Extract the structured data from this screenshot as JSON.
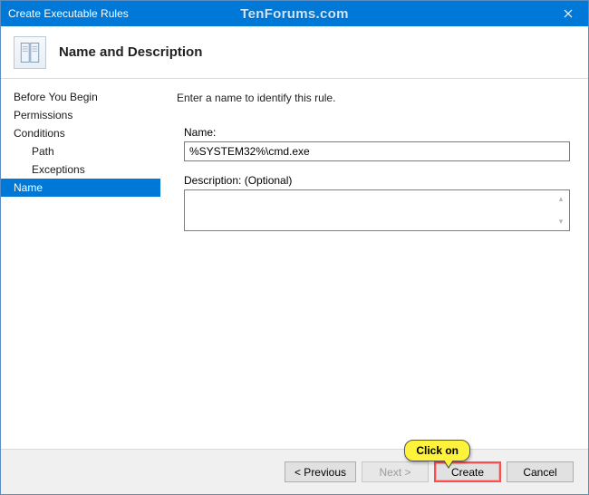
{
  "window": {
    "title": "Create Executable Rules",
    "watermark": "TenForums.com"
  },
  "header": {
    "heading": "Name and Description"
  },
  "sidebar": {
    "items": [
      {
        "label": "Before You Begin",
        "sub": false,
        "selected": false
      },
      {
        "label": "Permissions",
        "sub": false,
        "selected": false
      },
      {
        "label": "Conditions",
        "sub": false,
        "selected": false
      },
      {
        "label": "Path",
        "sub": true,
        "selected": false
      },
      {
        "label": "Exceptions",
        "sub": true,
        "selected": false
      },
      {
        "label": "Name",
        "sub": false,
        "selected": true
      }
    ]
  },
  "content": {
    "instruction": "Enter a name to identify this rule.",
    "name_label": "Name:",
    "name_value": "%SYSTEM32%\\cmd.exe",
    "desc_label": "Description: (Optional)",
    "desc_value": ""
  },
  "footer": {
    "previous": "< Previous",
    "next": "Next >",
    "create": "Create",
    "cancel": "Cancel"
  },
  "annotation": {
    "callout": "Click on"
  }
}
